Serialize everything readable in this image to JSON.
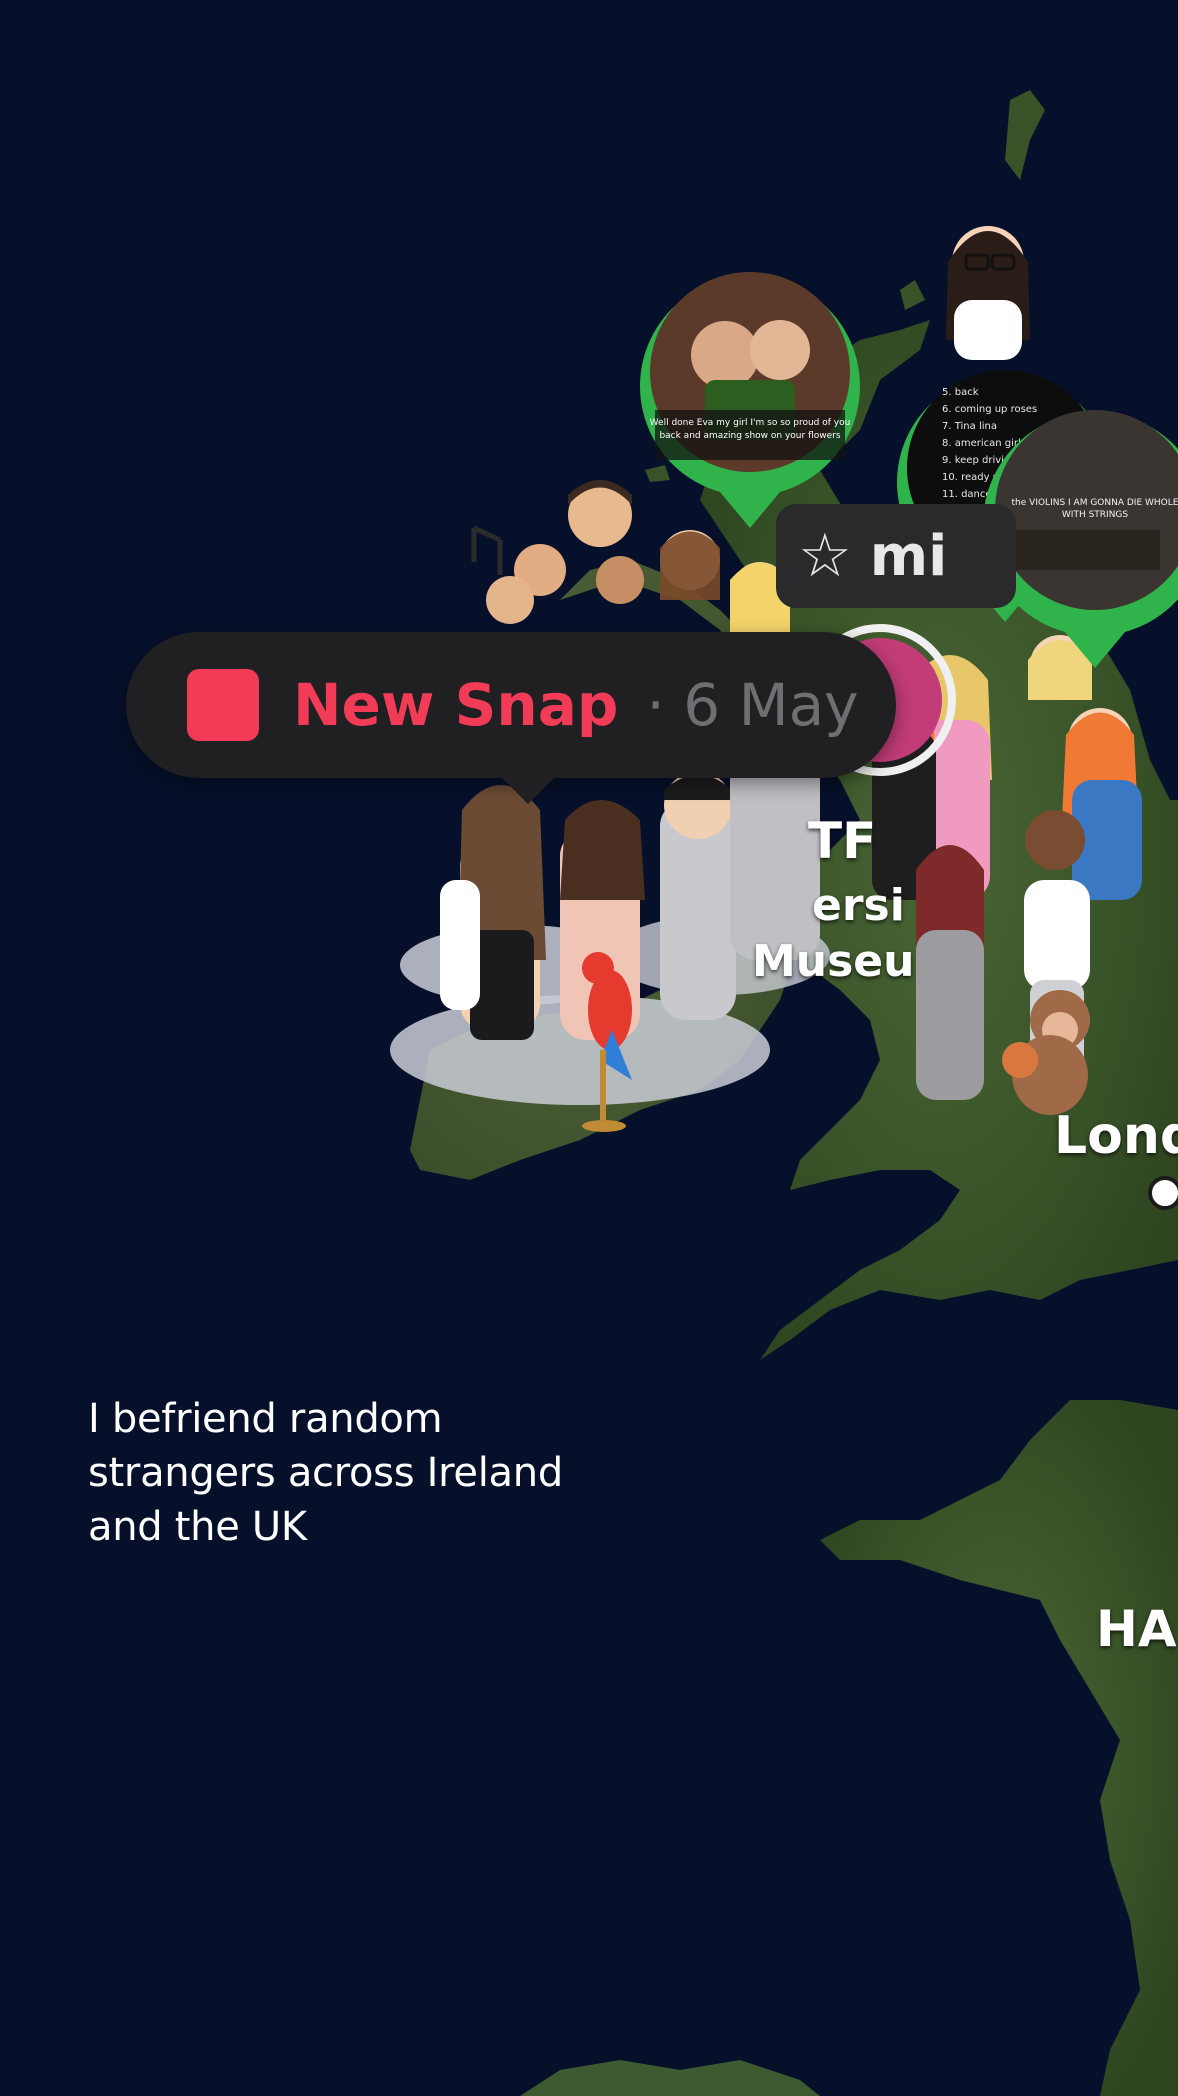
{
  "caption": {
    "lines": [
      "I befriend random",
      "strangers across Ireland",
      "and the UK"
    ]
  },
  "snap_pill": {
    "label": "New Snap",
    "date": "· 6 May",
    "accent_color": "#f23c57",
    "icon": "snap-square-icon"
  },
  "friend_pill": {
    "icon": "star-outline-icon",
    "name": "mi"
  },
  "map_labels": {
    "london": "Lond",
    "museum_line1": "TF",
    "museum_line2": "ersi",
    "museum_line3": "Museu",
    "haj": "HA"
  },
  "story_bubbles": [
    {
      "name": "story-bubble-photo",
      "ring_color": "#2fb34a",
      "text": "Well done Eva my girl I'm so so proud of you back and amazing show ..."
    },
    {
      "name": "story-bubble-list",
      "ring_color": "#2fb34a",
      "text": "7. Tina lina 8. american girls 9. keep driving 10. ready steady 11. dance no more 12. TPWK 13. pop"
    },
    {
      "name": "story-bubble-video",
      "ring_color": "#2fb34a",
      "text": "the VIOLINS I AM GONNA DIE WHOLE WITH STRINGS"
    }
  ],
  "colors": {
    "sea": "#06102a",
    "land": "#3d5a2c",
    "story_ring": "#2fb34a"
  }
}
